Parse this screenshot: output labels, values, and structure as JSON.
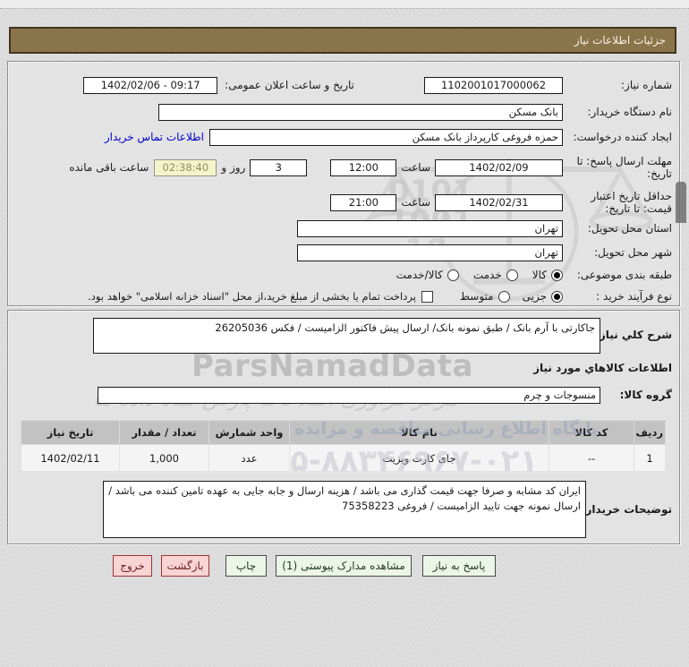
{
  "title": "جزئیات اطلاعات نیاز",
  "fields": {
    "need_number": {
      "label": "شماره نیاز:",
      "value": "1102001017000062"
    },
    "announce_datetime": {
      "label": "تاریخ و ساعت اعلان عمومی:",
      "value": "1402/02/06 - 09:17"
    },
    "buyer_org": {
      "label": "نام دستگاه خریدار:",
      "value": "بانک مسکن"
    },
    "request_creator": {
      "label": "ایجاد کننده درخواست:",
      "value": "حمزه فروغی کارپرداز بانک مسکن",
      "link": "اطلاعات تماس خریدار"
    },
    "reply_deadline": {
      "label": "مهلت ارسال پاسخ: تا تاریخ:",
      "date": "1402/02/09",
      "hour_label": "ساعت",
      "time": "12:00",
      "days": "3",
      "days_label": "روز و",
      "countdown": "02:38:40",
      "remaining_label": "ساعت باقی مانده"
    },
    "price_validity": {
      "label": "حداقل تاریخ اعتبار قیمت: تا تاریخ:",
      "date": "1402/02/31",
      "hour_label": "ساعت",
      "time": "21:00"
    },
    "province": {
      "label": "استان محل تحویل:",
      "value": "تهران"
    },
    "city": {
      "label": "شهر محل تحویل:",
      "value": "تهران"
    }
  },
  "classification": {
    "label": "طبقه بندی موضوعی:",
    "options": [
      {
        "label": "کالا",
        "selected": true
      },
      {
        "label": "خدمت",
        "selected": false
      },
      {
        "label": "کالا/خدمت",
        "selected": false
      }
    ]
  },
  "process_type": {
    "label": "نوع فرآیند خرید :",
    "options": [
      {
        "label": "جزیی",
        "selected": true
      },
      {
        "label": "متوسط",
        "selected": false
      }
    ],
    "checkbox_label": "پرداخت تمام یا بخشی از مبلغ خرید،از محل \"اسناد خزانه اسلامی\" خواهد بود.",
    "checkbox_checked": false
  },
  "need_description": {
    "label": "شرح کلي نیاز:",
    "value": "جاکارتی با آرم بانک  / طبق نمونه بانک/ ارسال پیش فاکتور الزامیست / فکس 26205036"
  },
  "goods_section": {
    "heading": "اطلاعات کالاهاي مورد نیاز",
    "group": {
      "label": "گروه کالا:",
      "value": "منسوجات و چرم"
    },
    "table": {
      "headers": [
        "ردیف",
        "کد کالا",
        "نام کالا",
        "واحد شمارش",
        "تعداد / مقدار",
        "تاریخ نیاز"
      ],
      "rows": [
        [
          "1",
          "--",
          "جای کارت ویزیت",
          "عدد",
          "1,000",
          "1402/02/11"
        ]
      ]
    }
  },
  "buyer_notes": {
    "label": "توضیحات خریدار:",
    "value": "ایران کد مشابه و صرفا جهت قیمت گذاری می باشد / هزینه ارسال و جابه جایی به عهده تامین کننده می باشد / ارسال نمونه جهت تایید الزامیست / فروغی 75358223"
  },
  "buttons": {
    "reply": "پاسخ به نیاز",
    "view_docs": "مشاهده مدارک پیوستی (1)",
    "print": "چاپ",
    "back": "بازگشت",
    "exit": "خروج"
  },
  "watermark": {
    "brand": "ParsNamadData",
    "calligraphy": "مرکز فرآوری اطلاعات پارس نماد داده ها",
    "site_line": "پایگاه اطلاع رسانی مناقصه و مزایده",
    "phone": "۵-۸۸۳۴۶۹۶۷-۰۲۱",
    "digits1": "0101",
    "digits2": "1001",
    "digits3": "10"
  },
  "colors": {
    "accent_brown": "#8a7449",
    "link_blue": "#0000cc",
    "countdown_bg": "#f4f4cb",
    "btn_green_bg": "#ecf6e8",
    "btn_pink_bg": "#f9d4d4",
    "table_header_bg": "#c2c2c2"
  }
}
